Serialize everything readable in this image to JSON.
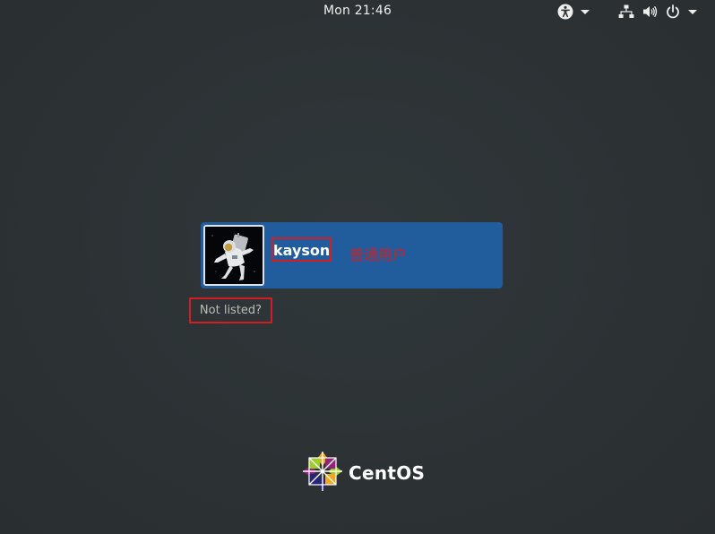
{
  "topbar": {
    "clock": "Mon 21:46",
    "icons": [
      "accessibility-icon",
      "network-icon",
      "volume-icon",
      "power-icon"
    ]
  },
  "user_list": {
    "users": [
      {
        "username": "kayson",
        "annotation": "普通用户",
        "avatar": "astronaut-avatar"
      }
    ],
    "not_listed_label": "Not listed?"
  },
  "branding": {
    "logo_text": "CentOS",
    "logo_icon": "centos-logo-icon"
  },
  "colors": {
    "background": "#2e3436",
    "user_row": "#215d9c",
    "annotation_red": "#d21e23",
    "text": "#eeeeec"
  }
}
